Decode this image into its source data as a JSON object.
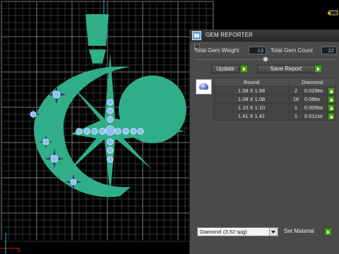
{
  "viewport": {
    "grid_color": "#7a7a7a",
    "shape_color": "#2fae88",
    "gem_color": "#8fbdf5",
    "star_color": "#2c3a66"
  },
  "panel": {
    "title": "GEM REPORTER",
    "title_icon": "gem-reporter-icon",
    "total_weight_label": "Total Gem Weight",
    "total_weight_value": "13",
    "total_count_label": "Total Gem Count",
    "total_count_value": "22",
    "update_label": "Update",
    "save_report_label": "Save Report",
    "table": {
      "headers": [
        "Round",
        "Diamond"
      ],
      "rows": [
        {
          "size": "1.58 X 1.58",
          "count": "2",
          "weight": "0.029tw"
        },
        {
          "size": "1.08 X 1.08",
          "count": "18",
          "weight": "0.08tw"
        },
        {
          "size": "1.10 X 1.10",
          "count": "1",
          "weight": "0.005tw"
        },
        {
          "size": "1.41 X 1.41",
          "count": "1",
          "weight": "0.011tw"
        }
      ]
    },
    "material": {
      "name": "Diamond",
      "sg": "(3.52 spg)"
    },
    "set_material_label": "Set Material",
    "accent_green": "#4c9a1c"
  }
}
